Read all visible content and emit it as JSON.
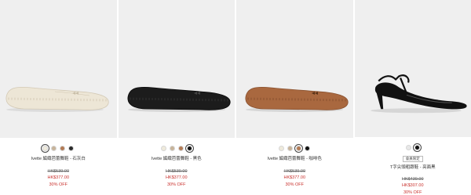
{
  "products": [
    {
      "name": "Ivette 編織芭蕾舞鞋 - 石灰白",
      "original_price": "HK$539.00",
      "sale_price": "HK$377.00",
      "discount": "30% OFF",
      "swatches": [
        "#efeadb",
        "#111111",
        "#b37b55",
        "#2b2b2b"
      ],
      "selected_swatch": 0,
      "shoe_color": "#ede6d6",
      "shoe_shadow": "#d8cfbd"
    },
    {
      "name": "Ivette 編織芭蕾舞鞋 - 黑色",
      "original_price": "HK$539.00",
      "sale_price": "HK$377.00",
      "discount": "30% OFF",
      "swatches": [
        "#efeadb",
        "#c8b49a",
        "#b37b55",
        "#111111"
      ],
      "selected_swatch": 3,
      "shoe_color": "#1c1c1c",
      "shoe_shadow": "#0a0a0a"
    },
    {
      "name": "Ivette 編織芭蕾舞鞋 - 咖啡色",
      "original_price": "HK$539.00",
      "sale_price": "HK$377.00",
      "discount": "30% OFF",
      "swatches": [
        "#efeadb",
        "#c8b49a",
        "#b37b55",
        "#111111"
      ],
      "selected_swatch": 2,
      "shoe_color": "#a9683f",
      "shoe_shadow": "#8a5230"
    },
    {
      "badge": "會員限定",
      "name": "T字尖頭粗跟鞋 - 亮面黑",
      "original_price": "HK$439.00",
      "sale_price": "HK$307.00",
      "discount": "30% OFF",
      "swatches": [
        "#e8e8e8",
        "#111111"
      ],
      "selected_swatch": 1,
      "shoe_color": "#111111",
      "shoe_shadow": "#000000"
    }
  ]
}
